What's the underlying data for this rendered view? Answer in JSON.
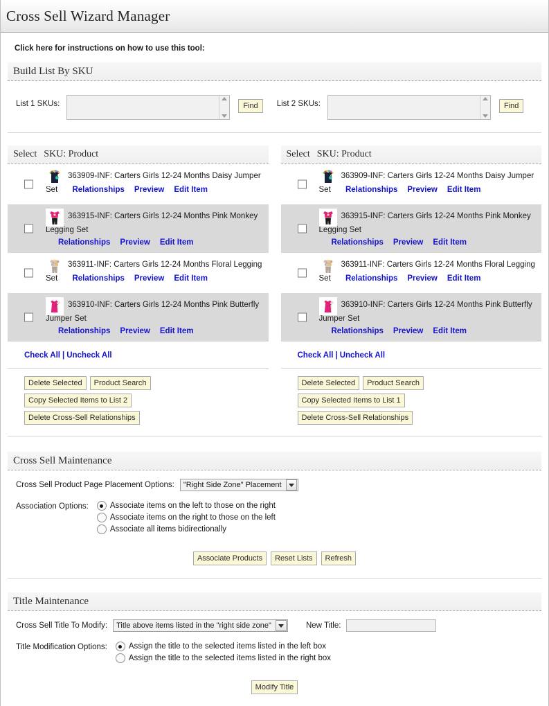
{
  "header": {
    "title": "Cross Sell Wizard Manager"
  },
  "instructions": {
    "text": "Click here for instructions on how to use this tool:"
  },
  "build_section": {
    "heading": "Build List By SKU",
    "list1": {
      "label": "List 1 SKUs:",
      "value": "",
      "find_button": "Find"
    },
    "list2": {
      "label": "List 2 SKUs:",
      "value": "",
      "find_button": "Find"
    }
  },
  "lists": {
    "column_headers": {
      "select": "Select",
      "product": "SKU: Product"
    },
    "links": {
      "relationships": "Relationships",
      "preview": "Preview",
      "edit": "Edit Item"
    },
    "check_all": "Check All",
    "uncheck_all": "Uncheck All",
    "separator": "|",
    "left": {
      "items": [
        {
          "sku": "363909-INF:",
          "name": "Carters Girls 12-24 Months Daisy Jumper Set",
          "thumb": "navy-daisy-jumper-thumbnail",
          "checked": false
        },
        {
          "sku": "363915-INF:",
          "name": "Carters Girls 12-24 Months Pink Monkey Legging Set",
          "thumb": "pink-monkey-legging-thumbnail",
          "checked": false
        },
        {
          "sku": "363911-INF:",
          "name": "Carters Girls 12-24 Months Floral Legging Set",
          "thumb": "floral-legging-thumbnail",
          "checked": false
        },
        {
          "sku": "363910-INF:",
          "name": "Carters Girls 12-24 Months Pink Butterfly Jumper Set",
          "thumb": "pink-butterfly-jumper-thumbnail",
          "checked": false
        }
      ],
      "buttons": [
        "Delete Selected",
        "Product Search",
        "Copy Selected Items to List 2",
        "Delete Cross-Sell Relationships"
      ]
    },
    "right": {
      "items": [
        {
          "sku": "363909-INF:",
          "name": "Carters Girls 12-24 Months Daisy Jumper Set",
          "thumb": "navy-daisy-jumper-thumbnail",
          "checked": false
        },
        {
          "sku": "363915-INF:",
          "name": "Carters Girls 12-24 Months Pink Monkey Legging Set",
          "thumb": "pink-monkey-legging-thumbnail",
          "checked": false
        },
        {
          "sku": "363911-INF:",
          "name": "Carters Girls 12-24 Months Floral Legging Set",
          "thumb": "floral-legging-thumbnail",
          "checked": false
        },
        {
          "sku": "363910-INF:",
          "name": "Carters Girls 12-24 Months Pink Butterfly Jumper Set",
          "thumb": "pink-butterfly-jumper-thumbnail",
          "checked": false
        }
      ],
      "buttons": [
        "Delete Selected",
        "Product Search",
        "Copy Selected Items to List 1",
        "Delete Cross-Sell Relationships"
      ]
    }
  },
  "cross_sell_maintenance": {
    "heading": "Cross Sell Maintenance",
    "placement_label": "Cross Sell Product Page Placement Options:",
    "placement_selected": "\"Right Side Zone\" Placement",
    "association_label": "Association Options:",
    "association_options": [
      {
        "label": "Associate items on the left to those on the right",
        "selected": true
      },
      {
        "label": "Associate items on the right to those on the left",
        "selected": false
      },
      {
        "label": "Associate all items bidirectionally",
        "selected": false
      }
    ],
    "buttons": [
      "Associate Products",
      "Reset Lists",
      "Refresh"
    ]
  },
  "title_maintenance": {
    "heading": "Title Maintenance",
    "title_to_modify_label": "Cross Sell Title To Modify:",
    "title_to_modify_selected": "Title above items listed in the \"right side zone\"",
    "new_title_label": "New Title:",
    "new_title_value": "",
    "modification_label": "Title Modification Options:",
    "modification_options": [
      {
        "label": "Assign the title to the selected items listed in the left box",
        "selected": true
      },
      {
        "label": "Assign the title to the selected items listed in the right box",
        "selected": false
      }
    ],
    "modify_button": "Modify Title"
  },
  "colors": {
    "link": "#1414cc",
    "button_bg": "#fbf8d8",
    "alt_row": "#d9d9d9"
  }
}
